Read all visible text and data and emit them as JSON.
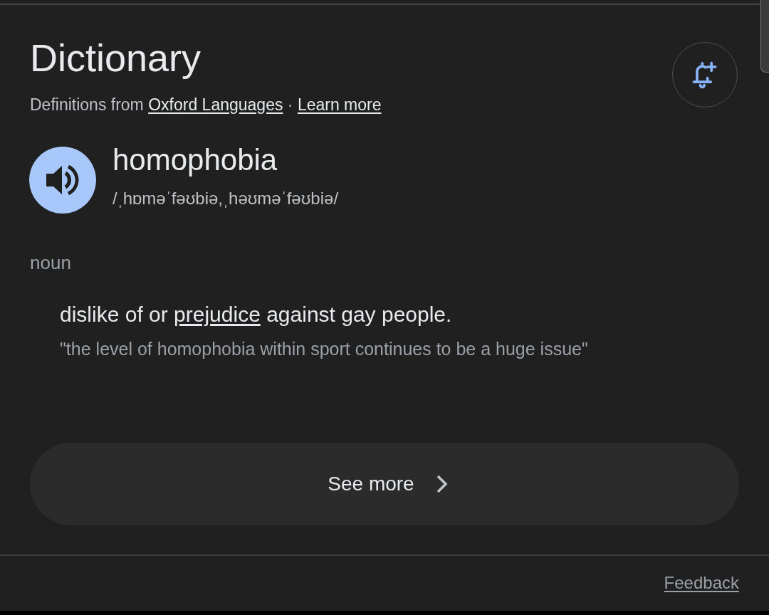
{
  "header": {
    "title": "Dictionary",
    "source": [
      {
        "kind": "text",
        "text": "Definitions from "
      },
      {
        "kind": "link",
        "text": "Oxford Languages"
      },
      {
        "kind": "text",
        "text": " · "
      },
      {
        "kind": "link",
        "text": "Learn more"
      }
    ]
  },
  "entry": {
    "word": "homophobia",
    "phonetic": "/ˌhɒməˈfəʊbiə,ˌhəʊməˈfəʊbiə/"
  },
  "senses": [
    {
      "part_of_speech": "noun",
      "definitions": [
        {
          "text": [
            {
              "kind": "text",
              "text": "dislike of or "
            },
            {
              "kind": "link",
              "text": "prejudice"
            },
            {
              "kind": "text",
              "text": " against gay people."
            }
          ],
          "example": "\"the level of homophobia within sport continues to be a huge issue\""
        }
      ]
    }
  ],
  "see_more": {
    "label": "See more"
  },
  "footer": {
    "feedback": "Feedback"
  }
}
